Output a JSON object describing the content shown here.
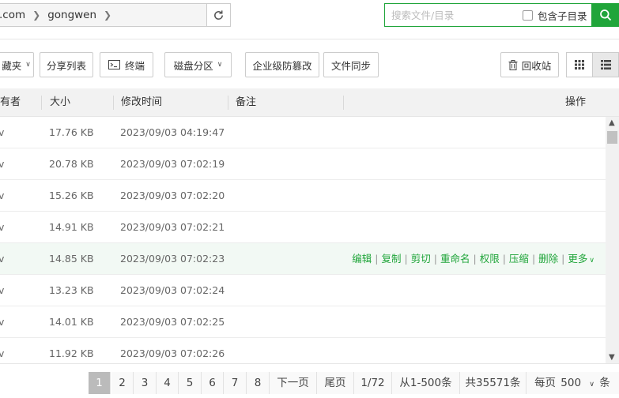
{
  "path": {
    "segments": [
      ".com",
      "gongwen"
    ]
  },
  "search": {
    "placeholder": "搜索文件/目录",
    "include_subdir_label": "包含子目录"
  },
  "toolbar": {
    "favorites_label": "藏夹",
    "share_list_label": "分享列表",
    "terminal_label": "终端",
    "disk_partition_label": "磁盘分区",
    "tamper_label": "企业级防篡改",
    "sync_label": "文件同步",
    "recycle_label": "回收站"
  },
  "table": {
    "headers": {
      "owner": "有者",
      "size": "大小",
      "mtime": "修改时间",
      "note": "备注",
      "ops": "操作"
    },
    "rows": [
      {
        "owner": "v",
        "size": "17.76 KB",
        "mtime": "2023/09/03 04:19:47"
      },
      {
        "owner": "v",
        "size": "20.78 KB",
        "mtime": "2023/09/03 07:02:19"
      },
      {
        "owner": "v",
        "size": "15.26 KB",
        "mtime": "2023/09/03 07:02:20"
      },
      {
        "owner": "v",
        "size": "14.91 KB",
        "mtime": "2023/09/03 07:02:21"
      },
      {
        "owner": "v",
        "size": "14.85 KB",
        "mtime": "2023/09/03 07:02:23"
      },
      {
        "owner": "v",
        "size": "13.23 KB",
        "mtime": "2023/09/03 07:02:24"
      },
      {
        "owner": "v",
        "size": "14.01 KB",
        "mtime": "2023/09/03 07:02:25"
      },
      {
        "owner": "v",
        "size": "11.92 KB",
        "mtime": "2023/09/03 07:02:26"
      }
    ],
    "row_actions": [
      "编辑",
      "复制",
      "剪切",
      "重命名",
      "权限",
      "压缩",
      "删除",
      "更多"
    ]
  },
  "pager": {
    "pages": [
      "1",
      "2",
      "3",
      "4",
      "5",
      "6",
      "7",
      "8"
    ],
    "next": "下一页",
    "last": "尾页",
    "page_info": "1/72",
    "range": "从1-500条",
    "total": "共35571条",
    "per_page_label": "每页",
    "per_page_value": "500",
    "per_page_unit": "条"
  },
  "colors": {
    "accent": "#20a53a"
  }
}
